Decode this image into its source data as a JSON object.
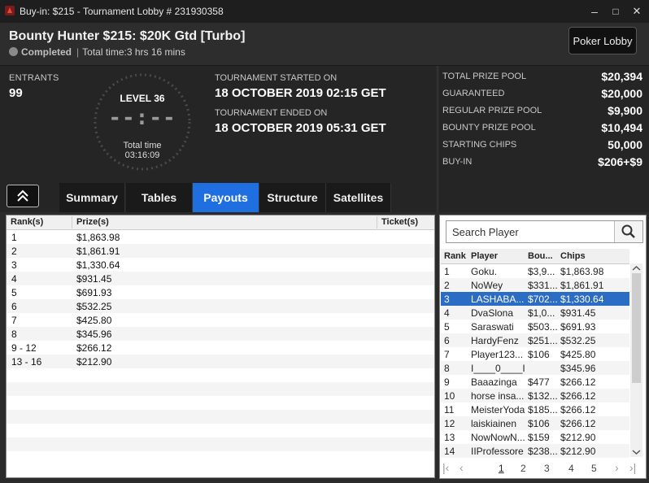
{
  "window": {
    "title": "Buy-in: $215 - Tournament Lobby # 231930358",
    "minimize_glyph": "–",
    "maximize_glyph": "□",
    "close_glyph": "✕"
  },
  "header": {
    "title": "Bounty Hunter $215: $20K Gtd [Turbo]",
    "status": "Completed",
    "total_time": "Total time:3 hrs  16 mins",
    "separator": "|",
    "lobby_button": "Poker Lobby"
  },
  "info": {
    "entrants_label": "ENTRANTS",
    "entrants_value": "99",
    "level": "LEVEL 36",
    "clock_digits": "--:--",
    "total_time_label": "Total time",
    "total_time_value": "03:16:09",
    "started_label": "TOURNAMENT STARTED ON",
    "started_value": "18 OCTOBER 2019  02:15 GET",
    "ended_label": "TOURNAMENT ENDED ON",
    "ended_value": "18 OCTOBER 2019  05:31 GET"
  },
  "prizes": [
    {
      "label": "TOTAL PRIZE POOL",
      "value": "$20,394"
    },
    {
      "label": "GUARANTEED",
      "value": "$20,000"
    },
    {
      "label": "REGULAR PRIZE POOL",
      "value": "$9,900"
    },
    {
      "label": "BOUNTY PRIZE POOL",
      "value": "$10,494"
    },
    {
      "label": "STARTING CHIPS",
      "value": "50,000"
    },
    {
      "label": "BUY-IN",
      "value": "$206+$9"
    }
  ],
  "tabs": [
    {
      "label": "Summary",
      "active": false
    },
    {
      "label": "Tables",
      "active": false
    },
    {
      "label": "Payouts",
      "active": true
    },
    {
      "label": "Structure",
      "active": false
    },
    {
      "label": "Satellites",
      "active": false
    }
  ],
  "payouts": {
    "headers": {
      "rank": "Rank(s)",
      "prize": "Prize(s)",
      "ticket": "Ticket(s)"
    },
    "rows": [
      {
        "rank": "1",
        "prize": "$1,863.98"
      },
      {
        "rank": "2",
        "prize": "$1,861.91"
      },
      {
        "rank": "3",
        "prize": "$1,330.64"
      },
      {
        "rank": "4",
        "prize": "$931.45"
      },
      {
        "rank": "5",
        "prize": "$691.93"
      },
      {
        "rank": "6",
        "prize": "$532.25"
      },
      {
        "rank": "7",
        "prize": "$425.80"
      },
      {
        "rank": "8",
        "prize": "$345.96"
      },
      {
        "rank": "9 - 12",
        "prize": "$266.12"
      },
      {
        "rank": "13 - 16",
        "prize": "$212.90"
      }
    ]
  },
  "players": {
    "search_placeholder": "Search Player",
    "headers": {
      "rank": "Rank",
      "player": "Player",
      "bounty": "Bou...",
      "chips": "Chips"
    },
    "rows": [
      {
        "rank": "1",
        "player": "Goku.",
        "bounty": "$3,9...",
        "chips": "$1,863.98"
      },
      {
        "rank": "2",
        "player": "NoWey",
        "bounty": "$331...",
        "chips": "$1,861.91"
      },
      {
        "rank": "3",
        "player": "LASHABA...",
        "bounty": "$702...",
        "chips": "$1,330.64"
      },
      {
        "rank": "4",
        "player": "DvaSlona",
        "bounty": "$1,0...",
        "chips": "$931.45"
      },
      {
        "rank": "5",
        "player": "Saraswati",
        "bounty": "$503...",
        "chips": "$691.93"
      },
      {
        "rank": "6",
        "player": "HardyFenz",
        "bounty": "$251...",
        "chips": "$532.25"
      },
      {
        "rank": "7",
        "player": "Player123...",
        "bounty": "$106",
        "chips": "$425.80"
      },
      {
        "rank": "8",
        "player": "I____0____I",
        "bounty": "",
        "chips": "$345.96"
      },
      {
        "rank": "9",
        "player": "Baaazinga",
        "bounty": "$477",
        "chips": "$266.12"
      },
      {
        "rank": "10",
        "player": "horse insa...",
        "bounty": "$132...",
        "chips": "$266.12"
      },
      {
        "rank": "11",
        "player": "MeisterYoda",
        "bounty": "$185...",
        "chips": "$266.12"
      },
      {
        "rank": "12",
        "player": "laiskiainen",
        "bounty": "$106",
        "chips": "$266.12"
      },
      {
        "rank": "13",
        "player": "NowNowN...",
        "bounty": "$159",
        "chips": "$212.90"
      },
      {
        "rank": "14",
        "player": "IIProfessore",
        "bounty": "$238...",
        "chips": "$212.90"
      }
    ],
    "selected_index": 2,
    "pages": [
      "1",
      "2",
      "3",
      "4",
      "5"
    ],
    "current_page": "1"
  }
}
